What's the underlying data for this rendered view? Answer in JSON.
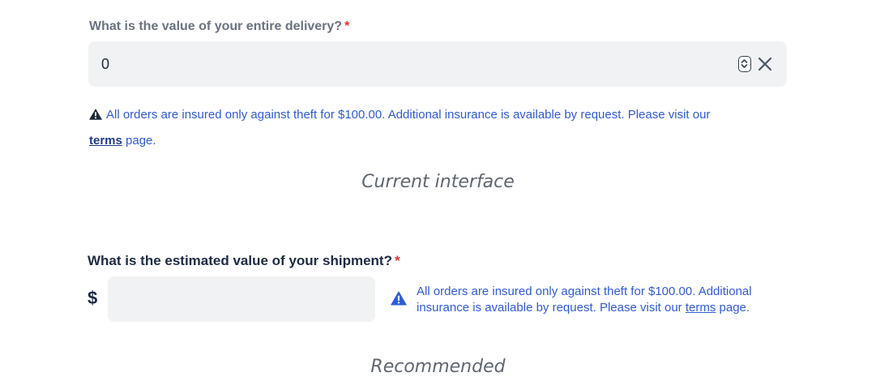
{
  "current": {
    "question": "What is the value of your entire delivery?",
    "required_mark": "*",
    "input_value": "0",
    "note_before_link": "All orders are insured only against theft for $100.00. Additional insurance is available by request. Please visit our",
    "link_label": "terms",
    "note_after_link": " page.",
    "caption": "Current interface"
  },
  "recommended": {
    "question": "What is the estimated value of your shipment?",
    "required_mark": "*",
    "currency_symbol": "$",
    "input_value": "",
    "note_before_link": "All orders are insured only against theft for $100.00. Additional insurance is available by request. Please visit our ",
    "link_label": "terms",
    "note_after_link": " page.",
    "caption": "Recommended"
  },
  "colors": {
    "link_blue": "#2f5bd6",
    "required_red": "#e03131",
    "input_bg": "#f1f2f4"
  },
  "icons": {
    "warning": "warning-triangle-icon",
    "spinner": "number-spinner-icon",
    "clear": "close-icon"
  }
}
